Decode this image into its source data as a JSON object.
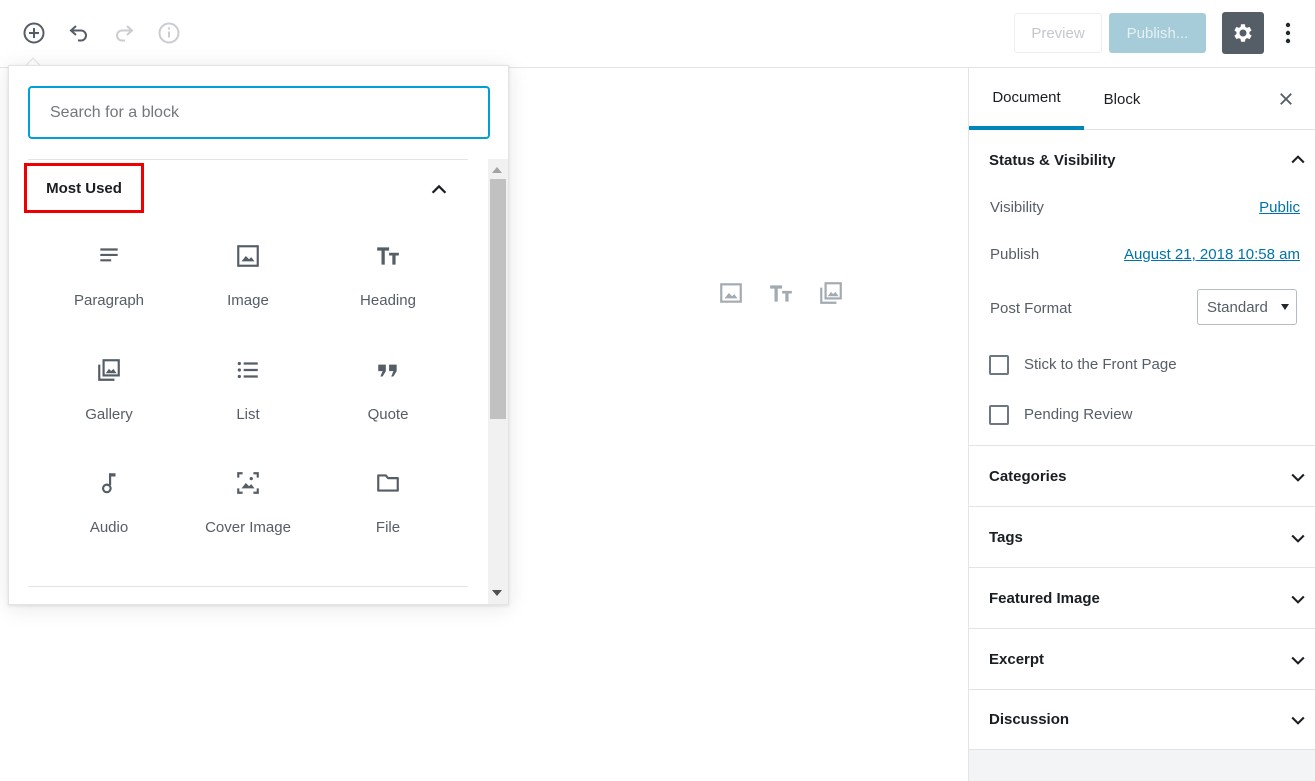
{
  "toolbar": {
    "add_icon": "plus-circle-icon",
    "undo_icon": "undo-icon",
    "redo_icon": "redo-icon",
    "info_icon": "info-icon",
    "preview_label": "Preview",
    "publish_label": "Publish...",
    "settings_icon": "gear-icon",
    "more_icon": "more-vertical-icon"
  },
  "inserter": {
    "search_placeholder": "Search for a block",
    "panel_title": "Most Used",
    "blocks": [
      {
        "label": "Paragraph",
        "icon": "paragraph-icon"
      },
      {
        "label": "Image",
        "icon": "image-icon"
      },
      {
        "label": "Heading",
        "icon": "heading-icon"
      },
      {
        "label": "Gallery",
        "icon": "gallery-icon"
      },
      {
        "label": "List",
        "icon": "list-icon"
      },
      {
        "label": "Quote",
        "icon": "quote-icon"
      },
      {
        "label": "Audio",
        "icon": "audio-icon"
      },
      {
        "label": "Cover Image",
        "icon": "cover-image-icon"
      },
      {
        "label": "File",
        "icon": "folder-icon"
      }
    ]
  },
  "canvas": {
    "icons": [
      "image-icon",
      "heading-icon",
      "gallery-icon"
    ]
  },
  "sidebar": {
    "tabs": [
      "Document",
      "Block"
    ],
    "active_tab": "Document",
    "status_visibility": {
      "title": "Status & Visibility",
      "visibility_label": "Visibility",
      "visibility_value": "Public",
      "publish_label": "Publish",
      "publish_value": "August 21, 2018 10:58 am",
      "post_format_label": "Post Format",
      "post_format_value": "Standard",
      "stick_label": "Stick to the Front Page",
      "pending_label": "Pending Review"
    },
    "sections": [
      "Categories",
      "Tags",
      "Featured Image",
      "Excerpt",
      "Discussion"
    ]
  },
  "colors": {
    "accent": "#0085ba",
    "link": "#0073aa",
    "highlight_box": "#ee0000",
    "publish_disabled": "#a6cbd9",
    "settings_bg": "#555d66"
  }
}
